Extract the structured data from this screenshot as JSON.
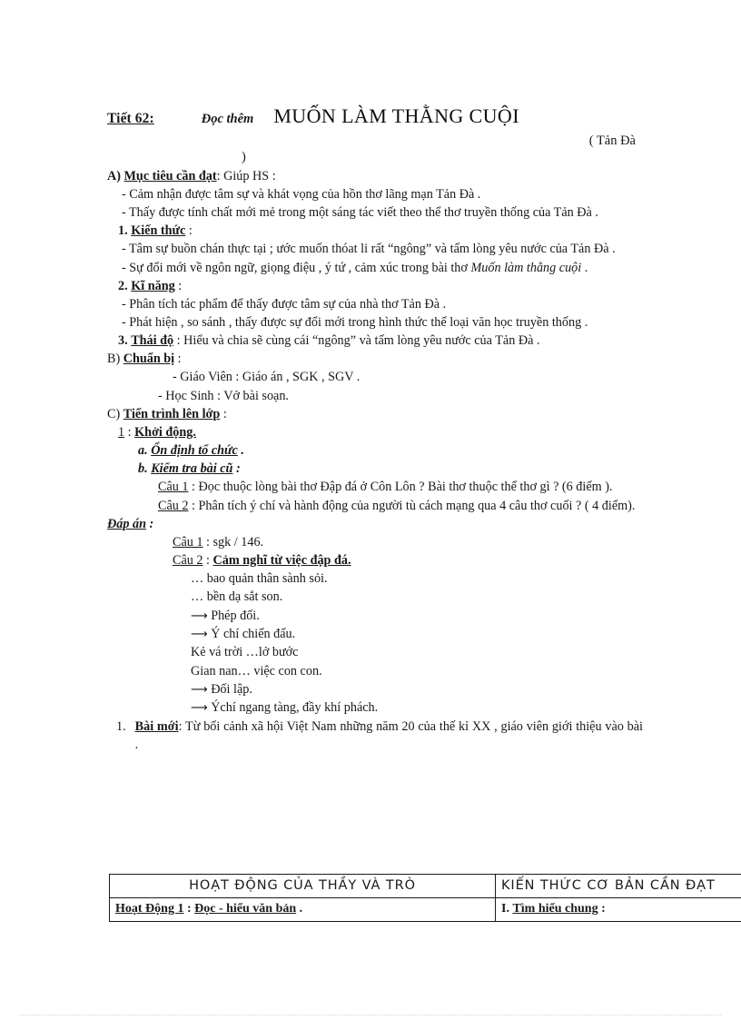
{
  "header": {
    "lesson_label": "Tiết 62:",
    "reading_label": "Đọc thêm",
    "title": "MUỐN LÀM THẰNG CUỘI",
    "author": "( Tản Đà",
    "paren_close": ")"
  },
  "sections": {
    "a_heading": "A)",
    "a_title": "Mục tiêu cần đạt",
    "a_rest": ": Giúp  HS :",
    "a_bullets": [
      "- Cảm nhận  được tâm sự và khát vọng  của hồn thơ lãng mạn Tản Đà .",
      "- Thấy được tính  chất  mới  mẻ  trong  một  sáng  tác viết  theo  thể  thơ truyền  thống  của Tản Đà ."
    ],
    "a1_num": "1.",
    "a1_title": "Kiến thức",
    "a1_rest": ":",
    "a1_bullets": [
      "- Tâm  sự buồn chán thực tại ; ước muốn  thóat li rất “ngông”  và tấm lòng  yêu nước của Tản Đà ."
    ],
    "a1_bullet2_pre": "- Sự đổi mới  về ngôn ngữ, giọng  điệu , ý tứ , cảm xúc trong bài thơ  ",
    "a1_bullet2_em": "Muốn làm thằng cuội",
    "a1_bullet2_post": " .",
    "a2_num": "2.",
    "a2_title": "Kĩ năng",
    "a2_rest": ":",
    "a2_bullets": [
      "- Phân tích tác phẩm  để thấy  được tâm  sự của nhà  thơ Tản Đà .",
      "- Phát hiện , so sánh , thấy được sự đổi mới  trong hình  thức thể loại văn học truyền thống ."
    ],
    "a3_num": "3.",
    "a3_title": "Thái độ",
    "a3_rest": ": Hiểu  và chia  sẽ cùng  cái “ngông”  và tấm lòng  yêu nước của Tản Đà .",
    "b_heading": "B)",
    "b_title": "Chuẩn  bị",
    "b_rest": ":",
    "b_bullets": [
      "- Giáo  Viên  : Giáo  án , SGK , SGV .",
      "- Học Sinh  : Vở bài soạn."
    ],
    "c_heading": "C)",
    "c_title": "Tiến trình  lên lớp",
    "c_rest": ":",
    "c1_num": "1",
    "c1_rest": ":",
    "c1_title": "Khởi  động.",
    "c1a_label": "a.",
    "c1a_title": "Ổn định tổ chức",
    "c1a_rest": ".",
    "c1b_label": "b.",
    "c1b_title": "Kiểm tra bài cũ",
    "c1b_rest": ":",
    "cau1_label": "Câu 1",
    "cau1_text": ": Đọc thuộc lòng  bài thơ Đập đá ở Côn Lôn ? Bài thơ thuộc  thể thơ gì ? (6 điểm ).",
    "cau2_label": "Câu 2",
    "cau2_text": ": Phân tích ý chí và hành  động của người tù cách mạng  qua 4 câu thơ cuối ? ( 4 điểm).",
    "dapan_title": "Đáp án",
    "dapan_rest": ":",
    "dapan_cau1_label": "Câu 1",
    "dapan_cau1_text": ": sgk / 146.",
    "dapan_cau2_label": "Câu 2",
    "dapan_cau2_sep": ": ",
    "dapan_cau2_text": "Cảm nghĩ từ việc đập đá.",
    "answer_lines": [
      "… bao quản thân  sành sỏi.",
      "… bền dạ sắt son."
    ],
    "arrow_1": "Phép đối.",
    "arrow_2": "Ý chí chiến  đấu.",
    "plain_1": "Kẻ vá trời  …lở bước",
    "plain_2": "Gian  nan…  việc  con con.",
    "arrow_3": "Đối lập.",
    "arrow_4": "Ýchí ngang  tàng,  đầy khí phách.",
    "baimoi_num": "1.",
    "baimoi_title": "Bài mới",
    "baimoi_text": ": Từ bối cảnh xã hội Việt Nam  những  năm 20 của thế kỉ XX , giáo  viên giới  thiệu  vào bài ."
  },
  "table": {
    "header_left": "HOẠT ĐỘNG CỦA THẦY VÀ TRÒ",
    "header_right": "KIẾN THỨC CƠ BẢN CẦN ĐẠT",
    "row1_left_label": "Hoạt Động 1",
    "row1_left_rest": " : ",
    "row1_left_underlined": "Đọc - hiểu văn bản",
    "row1_left_tail": " .",
    "row1_right_num": "I.",
    "row1_right_title": "Tìm  hiểu chung",
    "row1_right_rest": " :"
  },
  "colors": {
    "text": "#181818",
    "rule": "#1a1a1a",
    "footer_rule": "#f3c9d4",
    "page_bg": "#ffffff"
  }
}
